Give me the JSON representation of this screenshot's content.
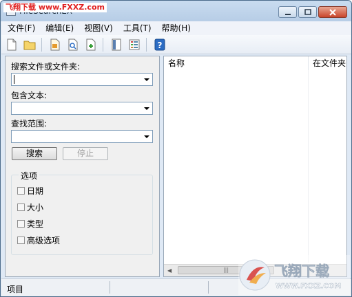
{
  "window": {
    "title": "FileSearchEX",
    "watermark": "飞翔下载 www.FXXZ.com"
  },
  "menu": [
    "文件(F)",
    "编辑(E)",
    "视图(V)",
    "工具(T)",
    "帮助(H)"
  ],
  "search": {
    "files_label": "搜索文件或文件夹:",
    "files_value": "",
    "text_label": "包含文本:",
    "text_value": "",
    "scope_label": "查找范围:",
    "scope_value": "",
    "search_button": "搜索",
    "stop_button": "停止"
  },
  "options": {
    "title": "选项",
    "items": [
      {
        "label": "日期",
        "checked": false
      },
      {
        "label": "大小",
        "checked": false
      },
      {
        "label": "类型",
        "checked": false
      },
      {
        "label": "高级选项",
        "checked": false
      }
    ]
  },
  "results": {
    "columns": [
      "名称",
      "在文件夹"
    ]
  },
  "status": {
    "label": "项目"
  },
  "logo": {
    "brand": "飞翔下载",
    "url": "WWW.FXXZ.COM"
  },
  "icons": [
    "new-file-icon",
    "open-folder-icon",
    "properties-icon",
    "preview-icon",
    "export-icon",
    "panel-icon",
    "grid-view-icon",
    "help-icon"
  ]
}
